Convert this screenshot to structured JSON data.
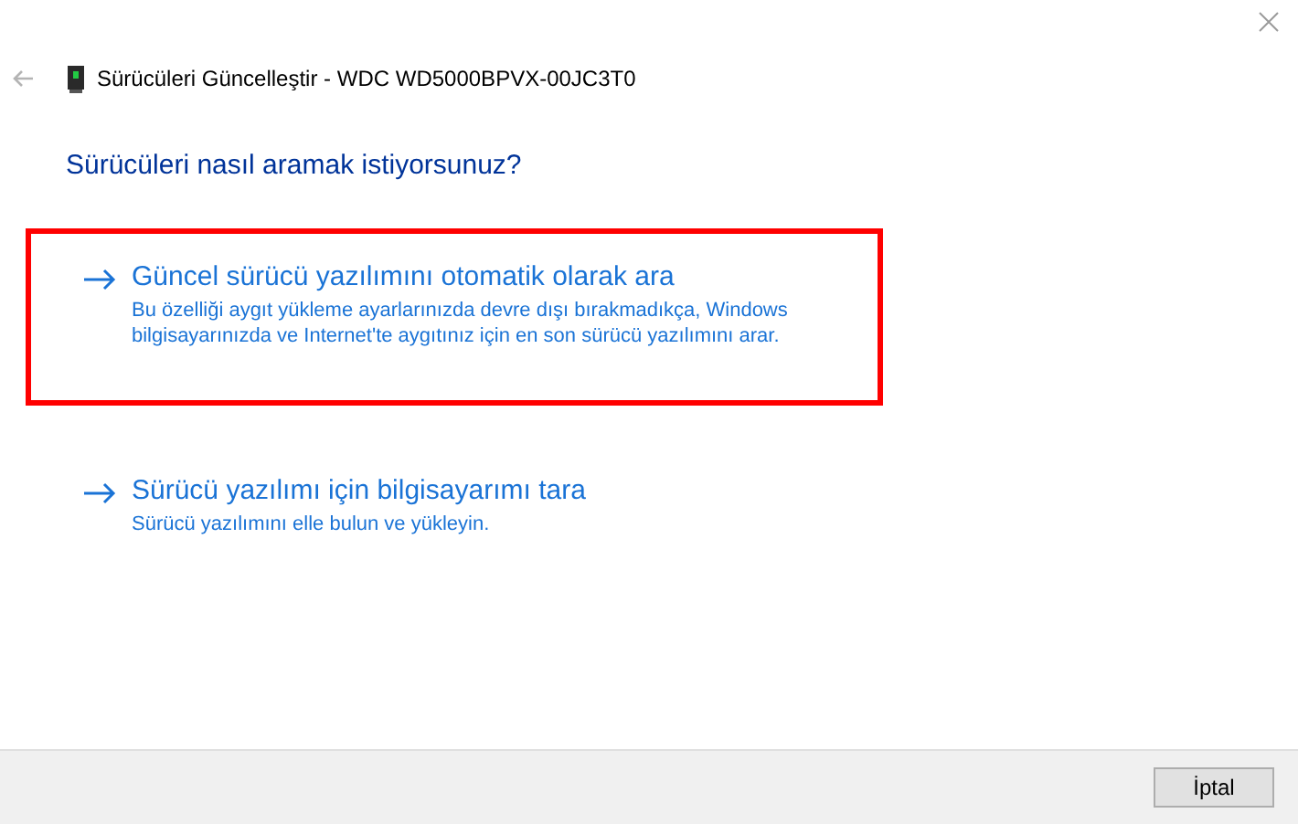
{
  "window": {
    "title": "Sürücüleri Güncelleştir - WDC WD5000BPVX-00JC3T0"
  },
  "heading": "Sürücüleri nasıl aramak istiyorsunuz?",
  "options": [
    {
      "title": "Güncel sürücü yazılımını otomatik olarak ara",
      "description": "Bu özelliği aygıt yükleme ayarlarınızda devre dışı bırakmadıkça, Windows bilgisayarınızda ve Internet'te aygıtınız için en son sürücü yazılımını arar.",
      "highlighted": true
    },
    {
      "title": "Sürücü yazılımı için bilgisayarımı tara",
      "description": "Sürücü yazılımını elle bulun ve yükleyin.",
      "highlighted": false
    }
  ],
  "buttons": [
    "İptal"
  ]
}
